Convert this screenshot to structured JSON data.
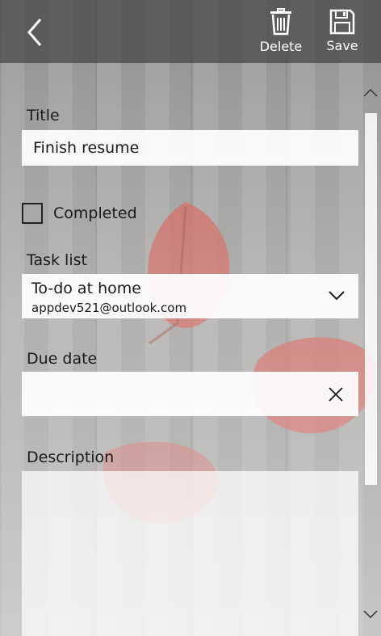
{
  "toolbar": {
    "delete_label": "Delete",
    "save_label": "Save"
  },
  "form": {
    "title_label": "Title",
    "title_value": "Finish resume",
    "completed_label": "Completed",
    "completed_checked": false,
    "task_list_label": "Task list",
    "task_list_value": "To-do at home",
    "task_list_account": "appdev521@outlook.com",
    "due_date_label": "Due date",
    "due_date_value": "",
    "description_label": "Description",
    "description_value": ""
  },
  "icons": {
    "back": "back-arrow-icon",
    "delete": "trash-icon",
    "save": "floppy-disk-icon",
    "dropdown": "chevron-down-icon",
    "clear": "close-icon",
    "scroll_up": "chevron-up-icon",
    "scroll_down": "chevron-down-icon"
  },
  "colors": {
    "topbar": "#505050",
    "field_bg": "#ffffff",
    "text": "#1a1a1a",
    "leaf": "#c9463c"
  }
}
